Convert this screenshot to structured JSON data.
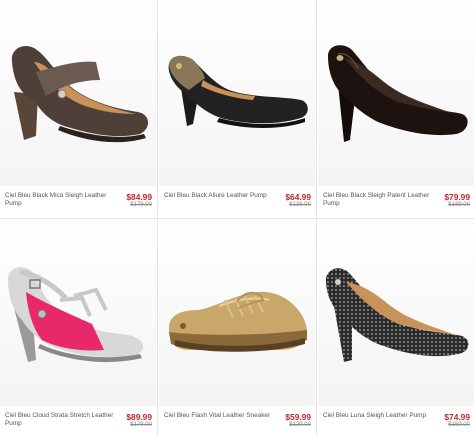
{
  "products": [
    {
      "name": "Ciel Bleu Black Mica Sleigh Leather Pump",
      "price": "$84.99",
      "old_price": "$179.00",
      "icon": "shoe-mary-jane-brown-icon"
    },
    {
      "name": "Ciel Bleu Black Allure Leather Pump",
      "price": "$64.99",
      "old_price": "$139.00",
      "icon": "shoe-peep-toe-black-icon"
    },
    {
      "name": "Ciel Bleu Black Sleigh Patent Leather Pump",
      "price": "$79.99",
      "old_price": "$169.00",
      "icon": "shoe-patent-pump-black-icon"
    },
    {
      "name": "Ciel Bleu Cloud Strata Stretch Leather Pump",
      "price": "$89.99",
      "old_price": "$179.00",
      "icon": "shoe-pink-grey-pump-icon"
    },
    {
      "name": "Ciel Bleu Flash Vital Leather Sneaker",
      "price": "$59.99",
      "old_price": "$129.00",
      "icon": "shoe-gold-sneaker-icon"
    },
    {
      "name": "Ciel Bleu Luna Sleigh Leather Pump",
      "price": "$74.99",
      "old_price": "$159.00",
      "icon": "shoe-polka-dot-pump-icon"
    }
  ],
  "colors": {
    "price": "#c0272d",
    "old_price": "#8a8a8a",
    "name": "#555555"
  }
}
